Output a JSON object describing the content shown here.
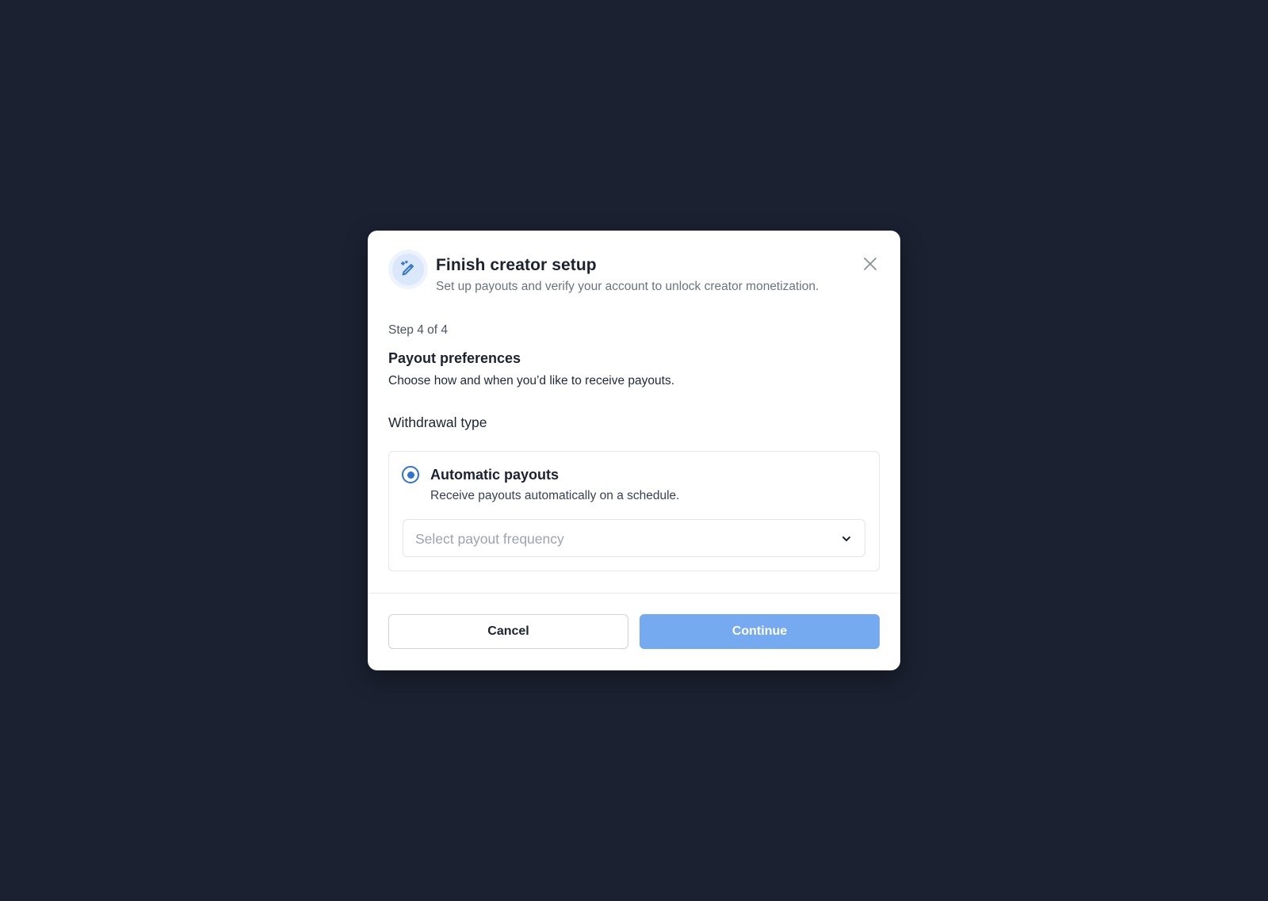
{
  "dialog": {
    "title": "Finish creator setup",
    "subtitle": "Set up payouts and verify your account to unlock creator monetization.",
    "icon": "magic-pencil-icon",
    "close_icon": "close-icon"
  },
  "step": {
    "label": "Step 4 of 4",
    "title": "Payout preferences",
    "description": "Choose how and when you’d like to receive payouts."
  },
  "withdrawal": {
    "label": "Withdrawal type",
    "option": {
      "title": "Automatic payouts",
      "description": "Receive payouts automatically on a schedule.",
      "selected": true
    },
    "frequency_select": {
      "placeholder": "Select payout frequency",
      "value": ""
    }
  },
  "footer": {
    "cancel_label": "Cancel",
    "continue_label": "Continue"
  },
  "colors": {
    "backdrop": "#1b2131",
    "accent": "#2f74d0",
    "continue_disabled": "#76aaf0"
  }
}
